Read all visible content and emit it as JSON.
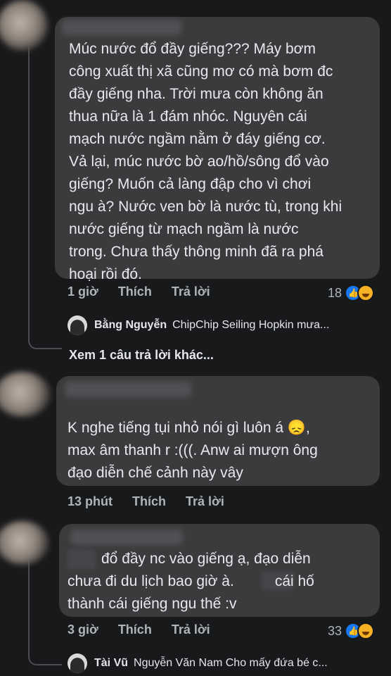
{
  "comments": [
    {
      "lines": [
        "Múc nước đổ đầy giếng??? Máy bơm",
        "công xuất thị xã cũng mơ có mà bơm đc",
        "đầy giếng nha. Trời mưa còn không ăn",
        "thua nữa là 1 đám nhóc. Nguyên cái",
        "mạch nước ngầm nằm ở đáy giếng cơ.",
        "Vả lại, múc nước bờ ao/hồ/sông đổ vào",
        "giếng? Muốn cả làng đập cho vì chơi",
        "ngu à? Nước ven bờ là nước tù, trong khi",
        "nước giếng từ mạch ngầm là nước",
        "trong. Chưa thấy thông minh đã ra phá",
        "hoại rồi đó."
      ],
      "time": "1 giờ",
      "like": "Thích",
      "reply": "Trả lời",
      "reaction_count": "18",
      "reply_preview": {
        "name": "Bằng Nguyễn",
        "text": "ChipChip Seiling Hopkin  mưa..."
      },
      "more_replies": "Xem 1 câu trả lời khác..."
    },
    {
      "lines": [
        "K nghe tiếng tụi nhỏ nói gì luôn á 😞,",
        "max âm thanh r :(((. Anw ai mượn ông",
        "đạo diễn chế cảnh này vây"
      ],
      "time": "13 phút",
      "like": "Thích",
      "reply": "Trả lời"
    },
    {
      "lines": [
        "đổ đầy nc vào giếng ạ, đạo diễn",
        "chưa đi du lịch bao giờ à.",
        "cái hố",
        "thành cái giếng ngu thế :v"
      ],
      "time": "3 giờ",
      "like": "Thích",
      "reply": "Trả lời",
      "reaction_count": "33",
      "reply_preview": {
        "name": "Tài Vũ",
        "text": "Nguyễn Văn Nam Cho mấy đứa bé c..."
      }
    }
  ],
  "colors": {
    "background": "#18191b",
    "bubble": "#3a3b3c",
    "secondary_text": "#b0b3b8",
    "like_blue": "#1877f2",
    "haha_yellow": "#f7b125"
  }
}
